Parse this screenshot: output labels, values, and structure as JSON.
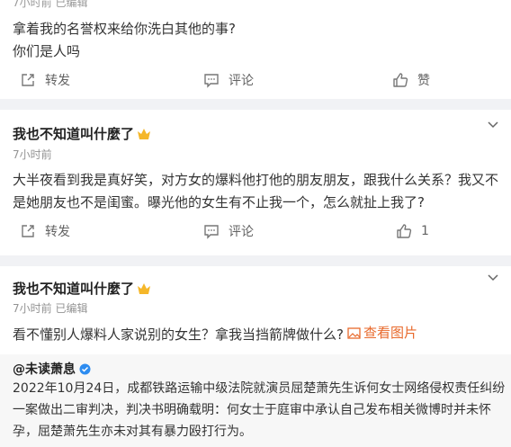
{
  "post1": {
    "meta": "7小时前  已编辑",
    "text_lines": [
      "拿着我的名誉权来给你洗白其他的事?",
      "你们是人吗"
    ],
    "actions": {
      "repost": "转发",
      "comment": "评论",
      "like": "赞"
    }
  },
  "post2": {
    "author": "我也不知道叫什麼了",
    "time": "7小时前",
    "text_lines": [
      "大半夜看到我是真好笑，对方女的爆料他打他的朋友朋友，跟我什么关系？我又不",
      "是她朋友也不是闺蜜。曝光他的女生有不止我一个，怎么就扯上我了?"
    ],
    "actions": {
      "repost": "转发",
      "comment": "评论",
      "like": "1"
    }
  },
  "post3": {
    "author": "我也不知道叫什麼了",
    "time": "7小时前  已编辑",
    "text": "看不懂别人爆料人家说别的女生？拿我当挡箭牌做什么?",
    "view_pic": "查看图片",
    "quote": {
      "author": "@未读萧息",
      "text_lines": [
        "2022年10月24日，成都铁路运输中级法院就演员屈楚萧先生诉何女士网络侵权责任纠纷",
        "一案做出二审判决，判决书明确载明：何女士于庭审中承认自己发布相关微博时并未怀",
        "孕，屈楚萧先生亦未对其有暴力殴打行为。"
      ]
    }
  },
  "colors": {
    "link_orange": "#e86a2c",
    "verify_blue": "#2d8cf0",
    "crown_gold": "#f5b72a",
    "separator": "#f1f2f5"
  }
}
